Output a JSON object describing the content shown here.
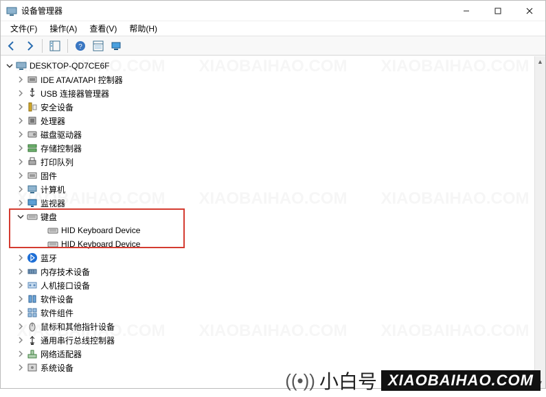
{
  "titlebar": {
    "title": "设备管理器"
  },
  "menu": {
    "file": "文件(F)",
    "action": "操作(A)",
    "view": "查看(V)",
    "help": "帮助(H)"
  },
  "toolbar_icons": {
    "back": "back-icon",
    "forward": "forward-icon",
    "show_hidden": "show-hidden-icon",
    "help": "help-icon",
    "list": "list-icon",
    "monitor": "monitor-icon"
  },
  "tree": {
    "root": {
      "label": "DESKTOP-QD7CE6F",
      "expanded": true
    },
    "nodes": [
      {
        "icon": "ide",
        "label": "IDE ATA/ATAPI 控制器",
        "expanded": false
      },
      {
        "icon": "usb",
        "label": "USB 连接器管理器",
        "expanded": false
      },
      {
        "icon": "security",
        "label": "安全设备",
        "expanded": false
      },
      {
        "icon": "cpu",
        "label": "处理器",
        "expanded": false
      },
      {
        "icon": "disk",
        "label": "磁盘驱动器",
        "expanded": false
      },
      {
        "icon": "storage",
        "label": "存储控制器",
        "expanded": false
      },
      {
        "icon": "printer",
        "label": "打印队列",
        "expanded": false
      },
      {
        "icon": "firmware",
        "label": "固件",
        "expanded": false
      },
      {
        "icon": "computer",
        "label": "计算机",
        "expanded": false
      },
      {
        "icon": "monitor",
        "label": "监视器",
        "expanded": false
      },
      {
        "icon": "keyboard",
        "label": "键盘",
        "expanded": true,
        "children": [
          {
            "icon": "keyboard",
            "label": "HID Keyboard Device"
          },
          {
            "icon": "keyboard",
            "label": "HID Keyboard Device"
          }
        ]
      },
      {
        "icon": "bluetooth",
        "label": "蓝牙",
        "expanded": false
      },
      {
        "icon": "memory",
        "label": "内存技术设备",
        "expanded": false
      },
      {
        "icon": "hid",
        "label": "人机接口设备",
        "expanded": false
      },
      {
        "icon": "softdev",
        "label": "软件设备",
        "expanded": false
      },
      {
        "icon": "softcomp",
        "label": "软件组件",
        "expanded": false
      },
      {
        "icon": "mouse",
        "label": "鼠标和其他指针设备",
        "expanded": false
      },
      {
        "icon": "usbctrl",
        "label": "通用串行总线控制器",
        "expanded": false
      },
      {
        "icon": "network",
        "label": "网络适配器",
        "expanded": false
      },
      {
        "icon": "system",
        "label": "系统设备",
        "expanded": false
      }
    ]
  },
  "watermark": {
    "cn": "小白号",
    "url": "XIAOBAIHAO.COM"
  }
}
